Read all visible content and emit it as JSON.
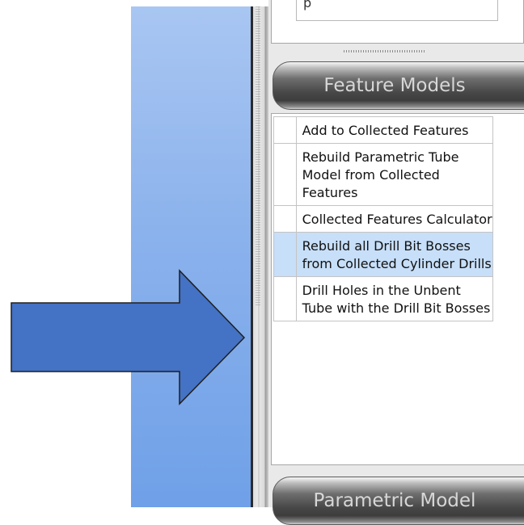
{
  "top_box": {
    "partial_text": "p"
  },
  "feature_models": {
    "title": "Feature Models",
    "items": [
      {
        "label": "Add to Collected Features",
        "selected": false
      },
      {
        "label": "Rebuild Parametric Tube Model from Collected Features",
        "selected": false
      },
      {
        "label": "Collected Features Calculator",
        "selected": false
      },
      {
        "label": "Rebuild all Drill Bit Bosses from Collected Cylinder Drills",
        "selected": true
      },
      {
        "label": "Drill Holes in the Unbent Tube with the Drill Bit Bosses",
        "selected": false
      }
    ]
  },
  "parametric_model": {
    "title": "Parametric Model"
  },
  "arrow": {
    "icon": "right-arrow-icon",
    "color": "#4472c4",
    "outline": "#1f1f1f"
  },
  "colors": {
    "selected_row": "#c7dff8",
    "left_strip": "#8bb2ec"
  }
}
